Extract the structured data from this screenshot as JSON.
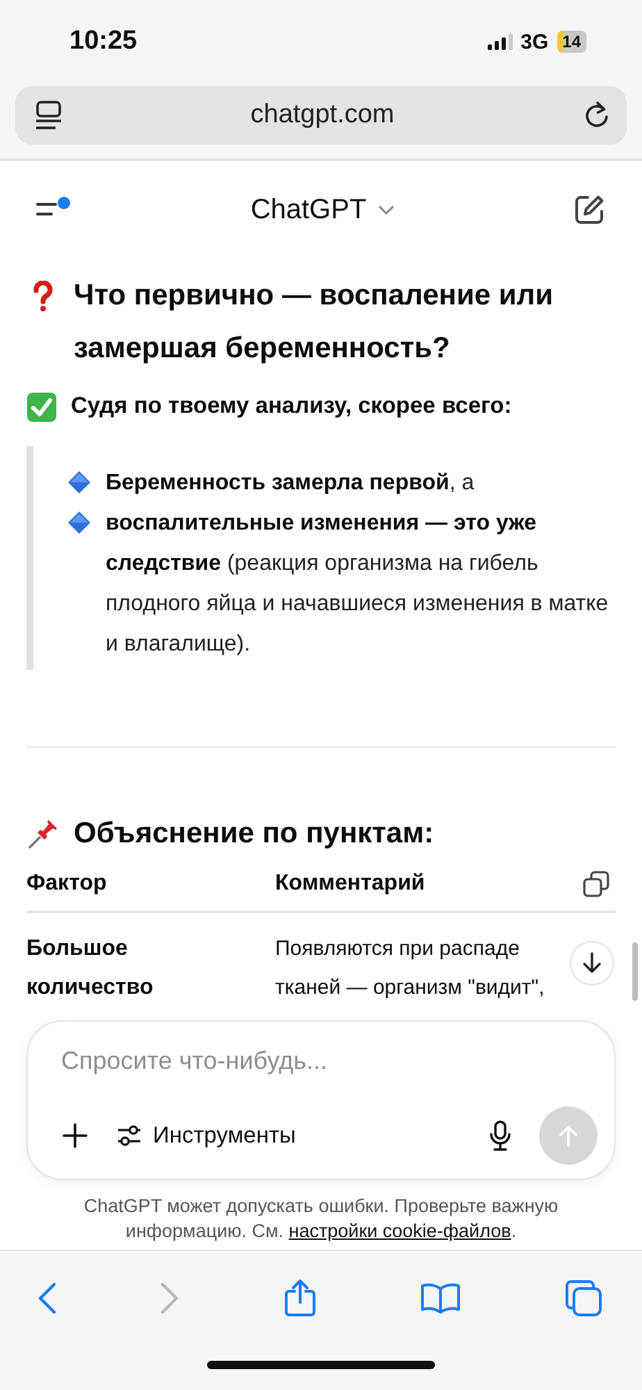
{
  "status_bar": {
    "time": "10:25",
    "network": "3G",
    "battery": "14"
  },
  "browser": {
    "url": "chatgpt.com"
  },
  "header": {
    "title": "ChatGPT",
    "notification": true
  },
  "message": {
    "heading": "Что первично — воспаление или замершая беременность?",
    "summary": "Судя по твоему анализу, скорее всего:",
    "quote_items": [
      "**Беременность замерла первой**, а",
      "**воспалительные изменения — это уже следствие** (реакция организма на гибель плодного яйца и начавшиеся изменения в матке и влагалище)."
    ],
    "section_title": "Объяснение по пунктам:",
    "table": {
      "columns": [
        "Фактор",
        "Комментарий"
      ],
      "rows": [
        [
          "Большое количество",
          "Появляются при распаде тканей — организм \"видит\","
        ]
      ]
    }
  },
  "composer": {
    "placeholder": "Спросите что-нибудь...",
    "tools_label": "Инструменты",
    "send_disabled": true
  },
  "disclaimer": {
    "text": "ChatGPT может допускать ошибки. Проверьте важную информацию. См. ",
    "link": "настройки cookie-файлов",
    "after": "."
  },
  "toolbar": [
    {
      "kind": "back",
      "disabled": false
    },
    {
      "kind": "forward",
      "disabled": true
    },
    {
      "kind": "share",
      "disabled": false
    },
    {
      "kind": "bookmarks",
      "disabled": false
    },
    {
      "kind": "tabs",
      "disabled": false
    }
  ]
}
